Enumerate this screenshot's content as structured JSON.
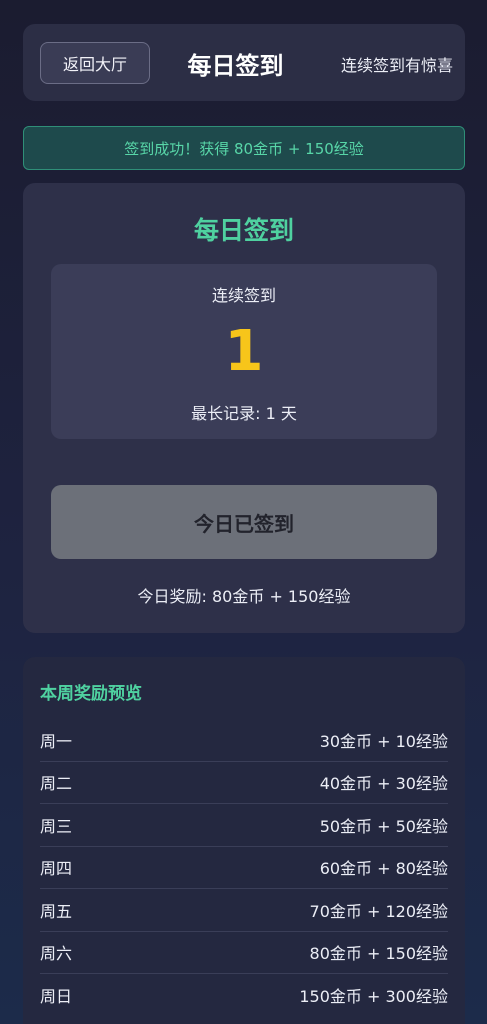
{
  "header": {
    "back_label": "返回大厅",
    "title": "每日签到",
    "subtitle": "连续签到有惊喜"
  },
  "banner": {
    "message": "签到成功！获得 80金币 + 150经验"
  },
  "checkin": {
    "title": "每日签到",
    "streak_label": "连续签到",
    "streak_count": "1",
    "record_text": "最长记录: 1 天",
    "button_label": "今日已签到",
    "today_reward": "今日奖励: 80金币 + 150经验"
  },
  "week": {
    "title": "本周奖励预览",
    "rows": [
      {
        "day": "周一",
        "reward": "30金币 + 10经验"
      },
      {
        "day": "周二",
        "reward": "40金币 + 30经验"
      },
      {
        "day": "周三",
        "reward": "50金币 + 50经验"
      },
      {
        "day": "周四",
        "reward": "60金币 + 80经验"
      },
      {
        "day": "周五",
        "reward": "70金币 + 120经验"
      },
      {
        "day": "周六",
        "reward": "80金币 + 150经验"
      },
      {
        "day": "周日",
        "reward": "150金币 + 300经验"
      }
    ]
  },
  "colors": {
    "accent": "#4fd1a0",
    "streak": "#f7c51a",
    "disabled_button": "#6c7079"
  }
}
